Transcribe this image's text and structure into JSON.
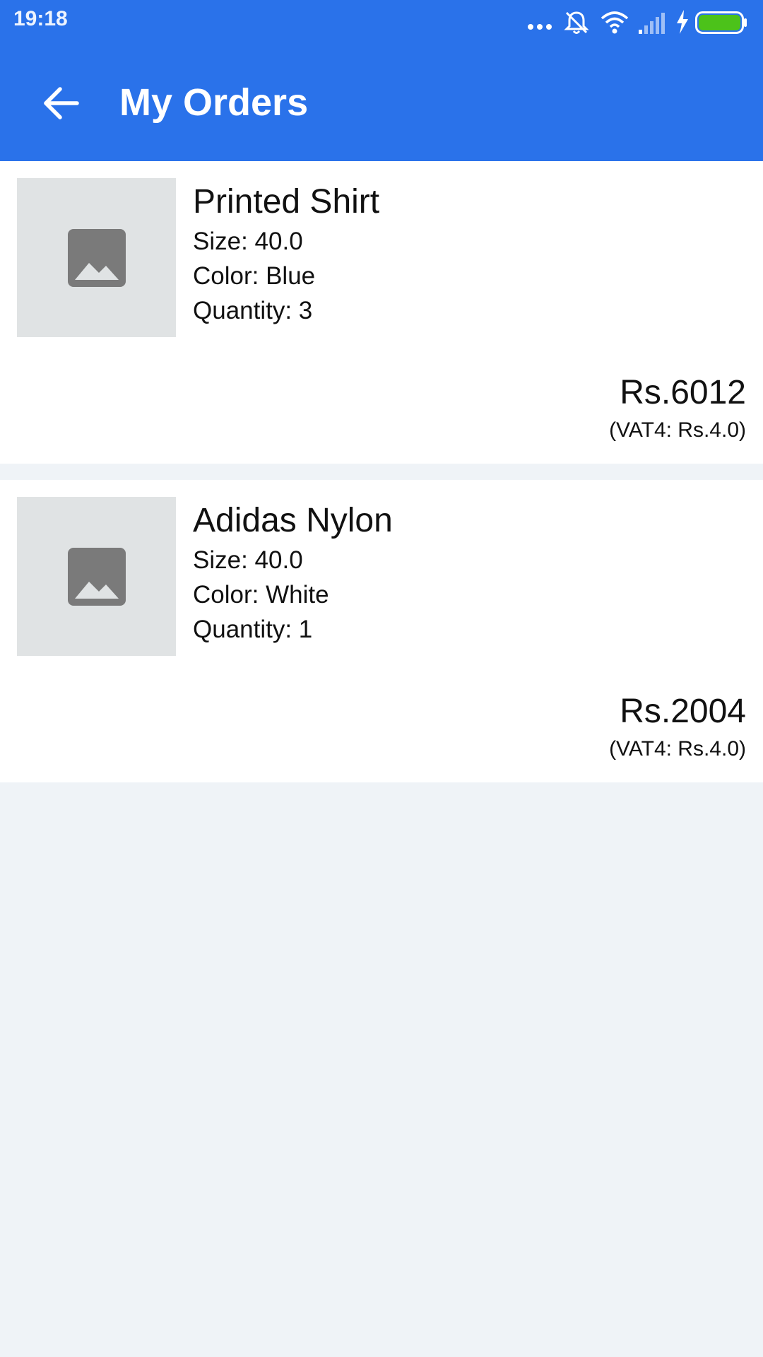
{
  "status_bar": {
    "time": "19:18",
    "icons": [
      "more-dots-icon",
      "silent-bell-icon",
      "wifi-icon",
      "signal-icon",
      "charging-icon",
      "battery-icon"
    ],
    "battery_color": "#4cc21a"
  },
  "toolbar": {
    "back_icon": "arrow-left-icon",
    "title": "My Orders",
    "background": "#2a72ea"
  },
  "orders": [
    {
      "name": "Printed Shirt",
      "size": "Size: 40.0",
      "color": "Color: Blue",
      "quantity": "Quantity: 3",
      "price": "Rs.6012",
      "vat": "(VAT4: Rs.4.0)",
      "image_icon": "image-placeholder-icon"
    },
    {
      "name": "Adidas Nylon",
      "size": "Size: 40.0",
      "color": "Color: White",
      "quantity": "Quantity: 1",
      "price": "Rs.2004",
      "vat": "(VAT4: Rs.4.0)",
      "image_icon": "image-placeholder-icon"
    }
  ]
}
